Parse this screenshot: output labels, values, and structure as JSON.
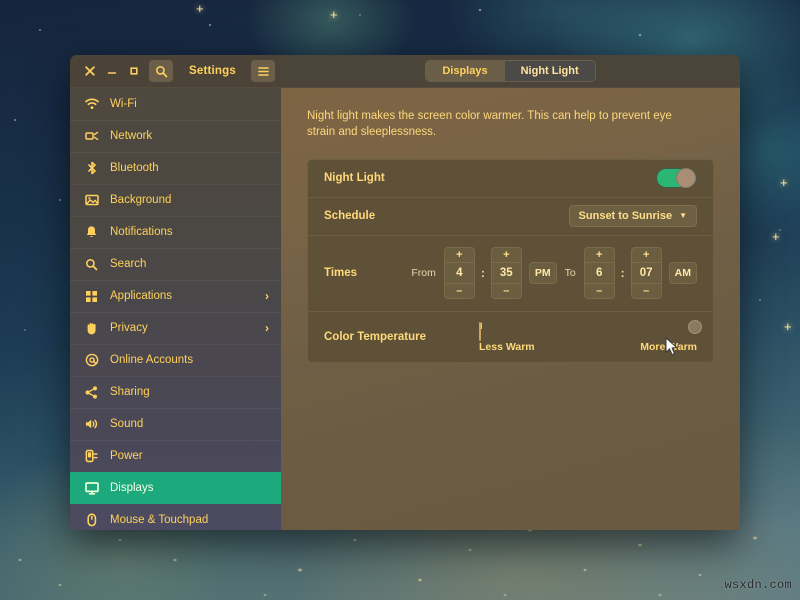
{
  "window": {
    "title": "Settings",
    "controls": {
      "close": "×",
      "minimize": "–",
      "maximize": "▫"
    },
    "search_icon": "search-icon",
    "menu_icon": "hamburger-menu-icon"
  },
  "tabs": [
    {
      "label": "Displays",
      "active": true
    },
    {
      "label": "Night Light",
      "active": false
    }
  ],
  "sidebar": {
    "items": [
      {
        "label": "Wi-Fi",
        "icon": "wifi-icon",
        "chevron": false,
        "selected": false
      },
      {
        "label": "Network",
        "icon": "network-icon",
        "chevron": false,
        "selected": false
      },
      {
        "label": "Bluetooth",
        "icon": "bluetooth-icon",
        "chevron": false,
        "selected": false
      },
      {
        "label": "Background",
        "icon": "background-icon",
        "chevron": false,
        "selected": false
      },
      {
        "label": "Notifications",
        "icon": "bell-icon",
        "chevron": false,
        "selected": false
      },
      {
        "label": "Search",
        "icon": "search-icon",
        "chevron": false,
        "selected": false
      },
      {
        "label": "Applications",
        "icon": "applications-icon",
        "chevron": true,
        "selected": false
      },
      {
        "label": "Privacy",
        "icon": "hand-icon",
        "chevron": true,
        "selected": false
      },
      {
        "label": "Online Accounts",
        "icon": "at-sign-icon",
        "chevron": false,
        "selected": false
      },
      {
        "label": "Sharing",
        "icon": "share-icon",
        "chevron": false,
        "selected": false
      },
      {
        "label": "Sound",
        "icon": "speaker-icon",
        "chevron": false,
        "selected": false
      },
      {
        "label": "Power",
        "icon": "power-plug-icon",
        "chevron": false,
        "selected": false
      },
      {
        "label": "Displays",
        "icon": "monitor-icon",
        "chevron": false,
        "selected": true
      },
      {
        "label": "Mouse & Touchpad",
        "icon": "mouse-icon",
        "chevron": false,
        "selected": false
      }
    ]
  },
  "main": {
    "description": "Night light makes the screen color warmer. This can help to prevent eye strain and sleeplessness.",
    "night_light": {
      "label": "Night Light",
      "enabled": true
    },
    "schedule": {
      "label": "Schedule",
      "value": "Sunset to Sunrise",
      "caret": "▼"
    },
    "times": {
      "label": "Times",
      "from_label": "From",
      "to_label": "To",
      "from_hour": "4",
      "from_minute": "35",
      "from_ampm": "PM",
      "to_hour": "6",
      "to_minute": "07",
      "to_ampm": "AM",
      "separator": ":",
      "increment": "+",
      "decrement": "–"
    },
    "color_temperature": {
      "label": "Color Temperature",
      "min_label": "Less Warm",
      "max_label": "More Warm",
      "value_percent": 100
    }
  },
  "colors": {
    "accent_green": "#1ea97c",
    "toggle_green": "#2bb673",
    "text_gold": "#ffd15c",
    "content_bg": "#6f5f45",
    "slider_start": "#ffe9a8",
    "slider_end": "#ea6a26"
  },
  "watermark": "wsxdn.com",
  "decor": {
    "plus_stars": [
      "+",
      "+",
      "+",
      "+",
      "+",
      "+"
    ]
  }
}
